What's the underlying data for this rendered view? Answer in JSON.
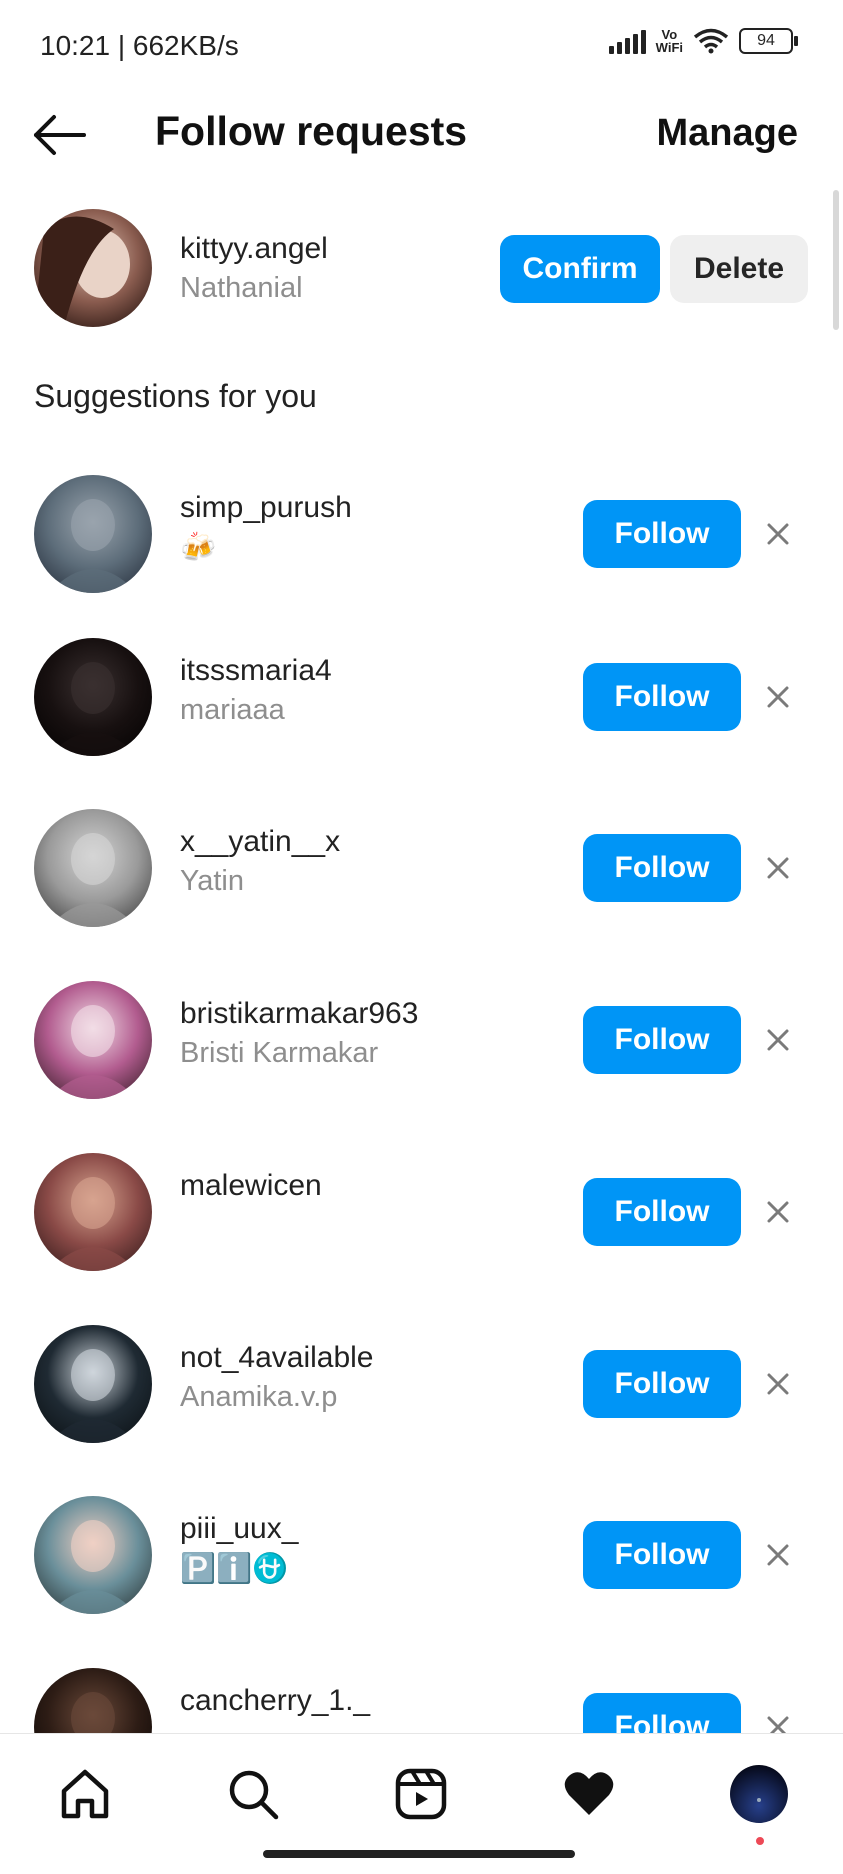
{
  "status_bar": {
    "time_speed": "10:21 | 662KB/s",
    "vowifi_top": "Vo",
    "vowifi_bottom": "WiFi",
    "battery": "94"
  },
  "header": {
    "title": "Follow requests",
    "manage_label": "Manage"
  },
  "request": {
    "username": "kittyy.angel",
    "name": "Nathanial",
    "confirm_label": "Confirm",
    "delete_label": "Delete"
  },
  "suggestions_title": "Suggestions for you",
  "follow_label": "Follow",
  "suggestions": [
    {
      "username": "simp_purush",
      "sub": "🍻"
    },
    {
      "username": "itsssmaria4",
      "sub": "mariaaa"
    },
    {
      "username": "x__yatin__x",
      "sub": "Yatin"
    },
    {
      "username": "bristikarmakar963",
      "sub": "Bristi Karmakar"
    },
    {
      "username": "malewicen",
      "sub": ""
    },
    {
      "username": "not_4available",
      "sub": "Anamika.v.p"
    },
    {
      "username": "piii_uux_",
      "sub": "🅿️ℹ️⛎"
    },
    {
      "username": "cancherry_1._",
      "sub": ""
    }
  ],
  "colors": {
    "accent": "#0095f6",
    "secondary_text": "#8e8e8e",
    "delete_bg": "#efefef",
    "notification_dot": "#ed4956"
  },
  "nav": [
    "home-icon",
    "search-icon",
    "reels-icon",
    "heart-icon",
    "profile-avatar"
  ]
}
